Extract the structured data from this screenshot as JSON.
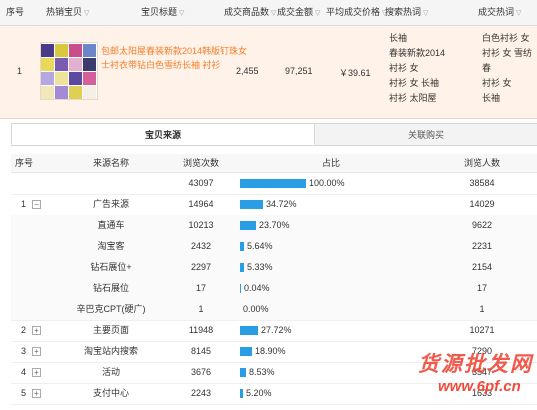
{
  "header": {
    "col_index": "序号",
    "col_product": "热销宝贝",
    "col_title": "宝贝标题",
    "col_qty": "成交商品数",
    "col_amount": "成交金额",
    "col_avg": "平均成交价格",
    "col_search": "搜索热词",
    "col_deal": "成交热词"
  },
  "product": {
    "index": "1",
    "title": "包邮太阳屋春装新款2014韩版钉珠女士衬衣带钻白色雪纺长袖 衬衫",
    "qty": "2,455",
    "amount": "97,251",
    "avg_price": "￥39.61",
    "search_terms": [
      "长袖",
      "春装新款2014",
      "衬衫 女",
      "衬衫 女 长袖",
      "衬衫 太阳屋"
    ],
    "deal_terms": [
      "白色衬衫 女",
      "衬衫 女 雪纺",
      "春",
      "衬衫 女",
      "长袖"
    ]
  },
  "tabs": {
    "active": "宝贝来源",
    "inactive": "关联购买"
  },
  "grid": {
    "headers": {
      "index": "序号",
      "source": "来源名称",
      "views": "浏览次数",
      "share": "占比",
      "visitors": "浏览人数"
    },
    "rows": [
      {
        "index": "",
        "toggle": "",
        "source": "",
        "views": "43097",
        "pct": "100.00%",
        "pct_value": 100.0,
        "visitors": "38584",
        "sub": false
      },
      {
        "index": "1",
        "toggle": "−",
        "source": "广告来源",
        "views": "14964",
        "pct": "34.72%",
        "pct_value": 34.72,
        "visitors": "14029",
        "sub": false
      },
      {
        "index": "",
        "toggle": "",
        "source": "直通车",
        "views": "10213",
        "pct": "23.70%",
        "pct_value": 23.7,
        "visitors": "9622",
        "sub": true
      },
      {
        "index": "",
        "toggle": "",
        "source": "淘宝客",
        "views": "2432",
        "pct": "5.64%",
        "pct_value": 5.64,
        "visitors": "2231",
        "sub": true
      },
      {
        "index": "",
        "toggle": "",
        "source": "钻石展位+",
        "views": "2297",
        "pct": "5.33%",
        "pct_value": 5.33,
        "visitors": "2154",
        "sub": true
      },
      {
        "index": "",
        "toggle": "",
        "source": "钻石展位",
        "views": "17",
        "pct": "0.04%",
        "pct_value": 0.04,
        "visitors": "17",
        "sub": true
      },
      {
        "index": "",
        "toggle": "",
        "source": "辛巴克CPT(硬广)",
        "views": "1",
        "pct": "0.00%",
        "pct_value": 0.0,
        "visitors": "1",
        "sub": true
      },
      {
        "index": "2",
        "toggle": "+",
        "source": "主要页面",
        "views": "11948",
        "pct": "27.72%",
        "pct_value": 27.72,
        "visitors": "10271",
        "sub": false
      },
      {
        "index": "3",
        "toggle": "+",
        "source": "淘宝站内搜索",
        "views": "8145",
        "pct": "18.90%",
        "pct_value": 18.9,
        "visitors": "7290",
        "sub": false
      },
      {
        "index": "4",
        "toggle": "+",
        "source": "活动",
        "views": "3676",
        "pct": "8.53%",
        "pct_value": 8.53,
        "visitors": "3547",
        "sub": false
      },
      {
        "index": "5",
        "toggle": "+",
        "source": "支付中心",
        "views": "2243",
        "pct": "5.20%",
        "pct_value": 5.2,
        "visitors": "1633",
        "sub": false
      }
    ]
  },
  "watermark": {
    "text": "货源批发网",
    "url": "www.6pf.cn"
  },
  "colors": {
    "bar": "#2a9ee4",
    "highlight_row": "#fff3e9",
    "title_link": "#f57d2a",
    "watermark": "#f04a3a"
  }
}
